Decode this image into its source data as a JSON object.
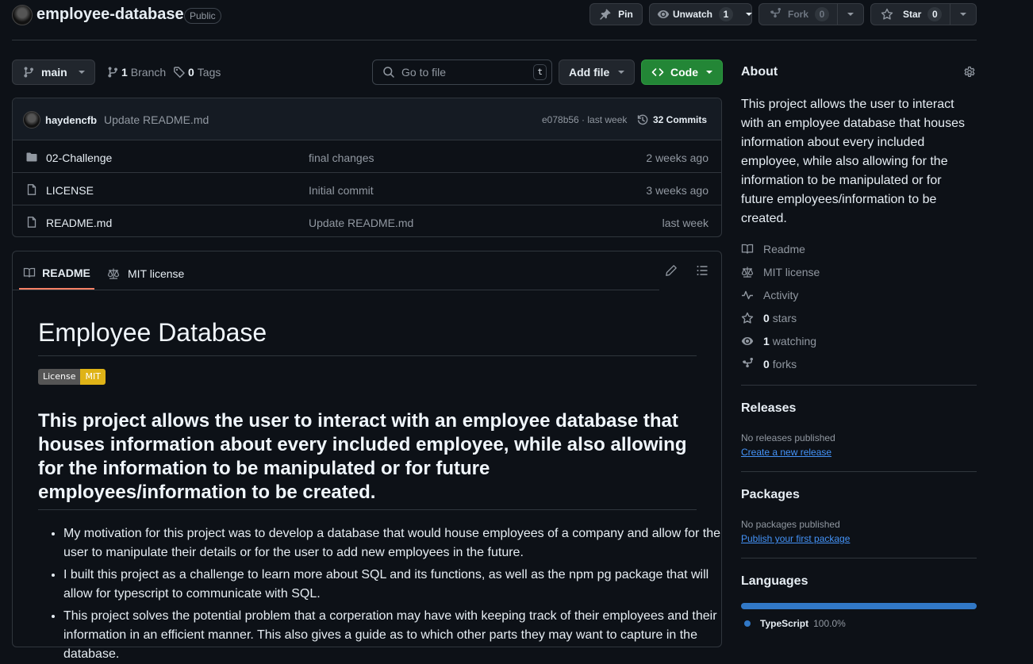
{
  "repo": {
    "name": "employee-database",
    "visibility": "Public"
  },
  "header_actions": {
    "pin": "Pin",
    "unwatch": "Unwatch",
    "watch_count": "1",
    "fork": "Fork",
    "fork_count": "0",
    "star": "Star",
    "star_count": "0"
  },
  "toolbar": {
    "branch": "main",
    "branch_count": "1",
    "branch_label": "Branch",
    "tag_count": "0",
    "tag_label": "Tags",
    "search_placeholder": "Go to file",
    "search_shortcut": "t",
    "add_file": "Add file",
    "code": "Code"
  },
  "latest_commit": {
    "author": "haydencfb",
    "message": "Update README.md",
    "hash_time": "e078b56 · last week",
    "commits": "32 Commits"
  },
  "files": [
    {
      "name": "02-Challenge",
      "type": "folder",
      "message": "final changes",
      "time": "2 weeks ago"
    },
    {
      "name": "LICENSE",
      "type": "file",
      "message": "Initial commit",
      "time": "3 weeks ago"
    },
    {
      "name": "README.md",
      "type": "file",
      "message": "Update README.md",
      "time": "last week"
    }
  ],
  "readme_tabs": {
    "readme": "README",
    "license": "MIT license"
  },
  "readme": {
    "title": "Employee Database",
    "badge_left": "License",
    "badge_right": "MIT",
    "subtitle": "This project allows the user to interact with an employee database that houses information about every included employee, while also allowing for the information to be manipulated or for future employees/information to be created.",
    "bullets": [
      "My motivation for this project was to develop a database that would house employees of a company and allow for the user to manipulate their details or for the user to add new employees in the future.",
      "I built this project as a challenge to learn more about SQL and its functions, as well as the npm pg package that will allow for typescript to communicate with SQL.",
      "This project solves the potential problem that a corperation may have with keeping track of their employees and their information in an efficient manner. This also gives a guide as to which other parts they may want to capture in the database."
    ]
  },
  "about": {
    "heading": "About",
    "description": "This project allows the user to interact with an employee database that houses information about every included employee, while also allowing for the information to be manipulated or for future employees/information to be created.",
    "readme": "Readme",
    "license": "MIT license",
    "activity": "Activity",
    "stars_count": "0",
    "stars_label": "stars",
    "watching_count": "1",
    "watching_label": "watching",
    "forks_count": "0",
    "forks_label": "forks"
  },
  "releases": {
    "heading": "Releases",
    "empty": "No releases published",
    "link": "Create a new release"
  },
  "packages": {
    "heading": "Packages",
    "empty": "No packages published",
    "link": "Publish your first package"
  },
  "languages": {
    "heading": "Languages",
    "items": [
      {
        "name": "TypeScript",
        "percent": "100.0%",
        "color": "#3178c6"
      }
    ]
  },
  "colors": {
    "background": "#0d1117",
    "accent_green": "#238636",
    "link": "#4493f8",
    "tab_underline": "#f78166"
  }
}
